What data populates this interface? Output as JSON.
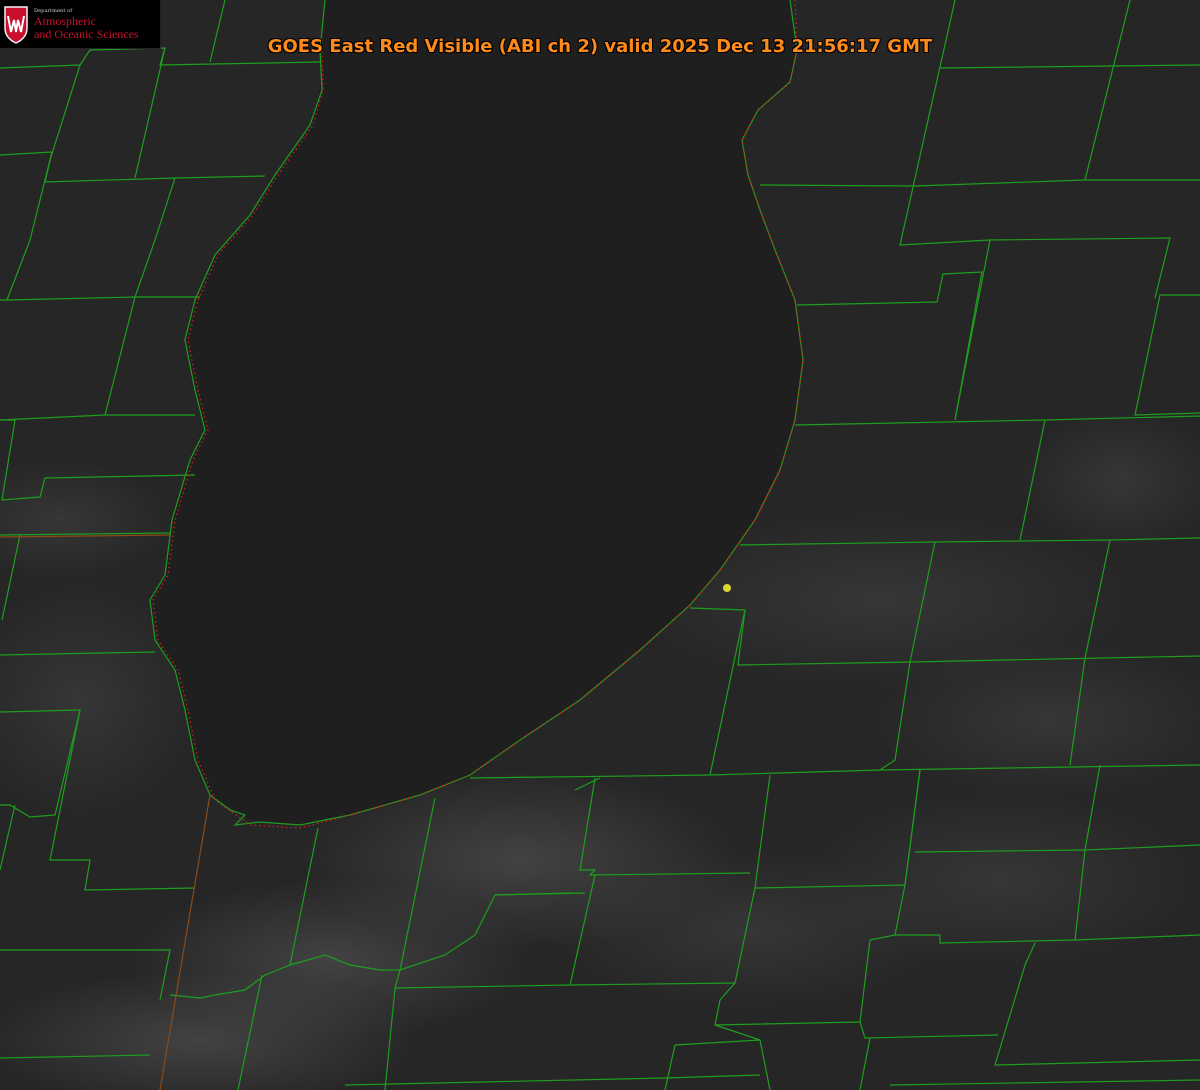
{
  "title": "GOES East Red Visible (ABI ch 2) valid 2025 Dec 13 21:56:17 GMT",
  "logo": {
    "department_line": "Department of",
    "name_line1": "Atmospheric",
    "name_line2": "and Oceanic Sciences"
  },
  "map": {
    "layers": [
      "satellite-visible-imagery",
      "county-boundaries",
      "state-boundary",
      "lake-shoreline",
      "site-marker"
    ],
    "colors": {
      "land": "#262626",
      "lake": "#1f1f1f",
      "county_lines": "#1e9e1e",
      "shoreline_dots": "#d21e1e",
      "state_boundary": "#8a4a1a",
      "marker": "#d8d830",
      "title": "#ff8a1c"
    },
    "icons": [
      "university-crest-icon",
      "site-marker-dot"
    ]
  }
}
